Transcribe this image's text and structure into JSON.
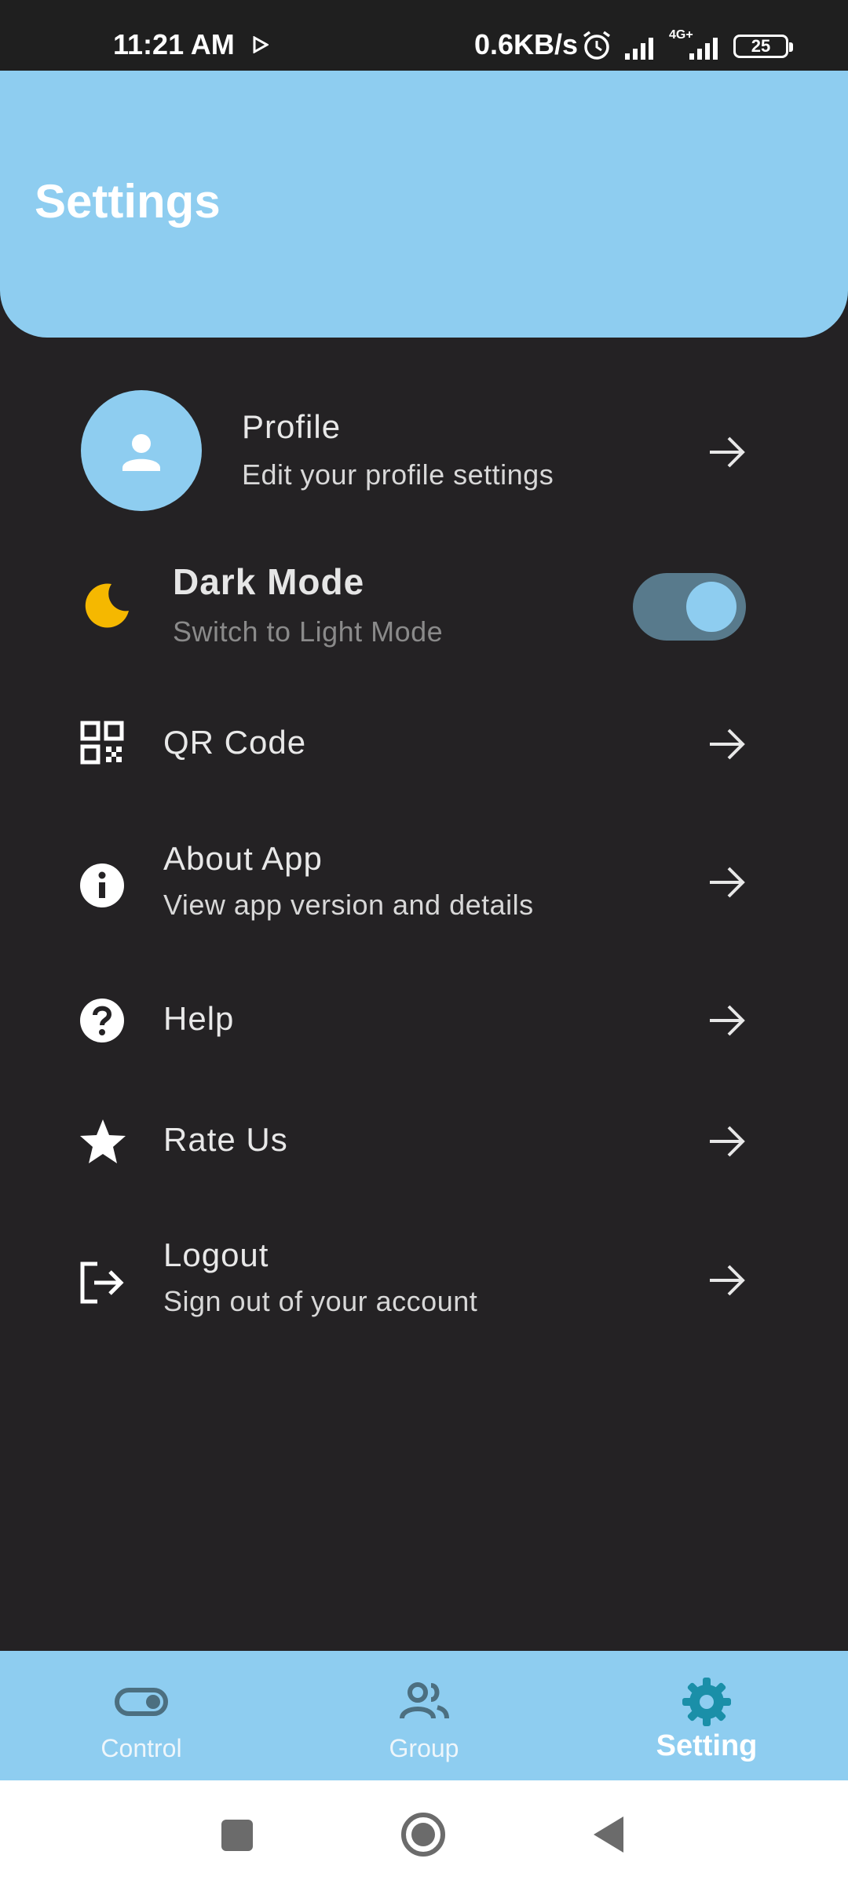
{
  "status_bar": {
    "time": "11:21 AM",
    "net_speed": "0.6KB/s",
    "network_label": "4G+",
    "battery": "25"
  },
  "header": {
    "title": "Settings"
  },
  "items": {
    "profile": {
      "title": "Profile",
      "subtitle": "Edit your profile settings",
      "icon": "person-icon"
    },
    "dark_mode": {
      "title": "Dark Mode",
      "subtitle": "Switch to Light Mode",
      "icon": "moon-icon",
      "enabled": true
    },
    "qr_code": {
      "title": "QR Code",
      "icon": "qr-code-icon"
    },
    "about": {
      "title": "About App",
      "subtitle": "View app version and details",
      "icon": "info-icon"
    },
    "help": {
      "title": "Help",
      "icon": "help-icon"
    },
    "rate": {
      "title": "Rate Us",
      "icon": "star-icon"
    },
    "logout": {
      "title": "Logout",
      "subtitle": "Sign out of your account",
      "icon": "logout-icon"
    }
  },
  "bottom_nav": {
    "items": [
      {
        "label": "Control",
        "icon": "toggle-icon",
        "active": false
      },
      {
        "label": "Group",
        "icon": "group-icon",
        "active": false
      },
      {
        "label": "Setting",
        "icon": "gear-icon",
        "active": true
      }
    ]
  },
  "colors": {
    "accent": "#8ecdf0",
    "background": "#242224",
    "active_nav_icon": "#1a8fa8",
    "moon": "#f5b800"
  }
}
